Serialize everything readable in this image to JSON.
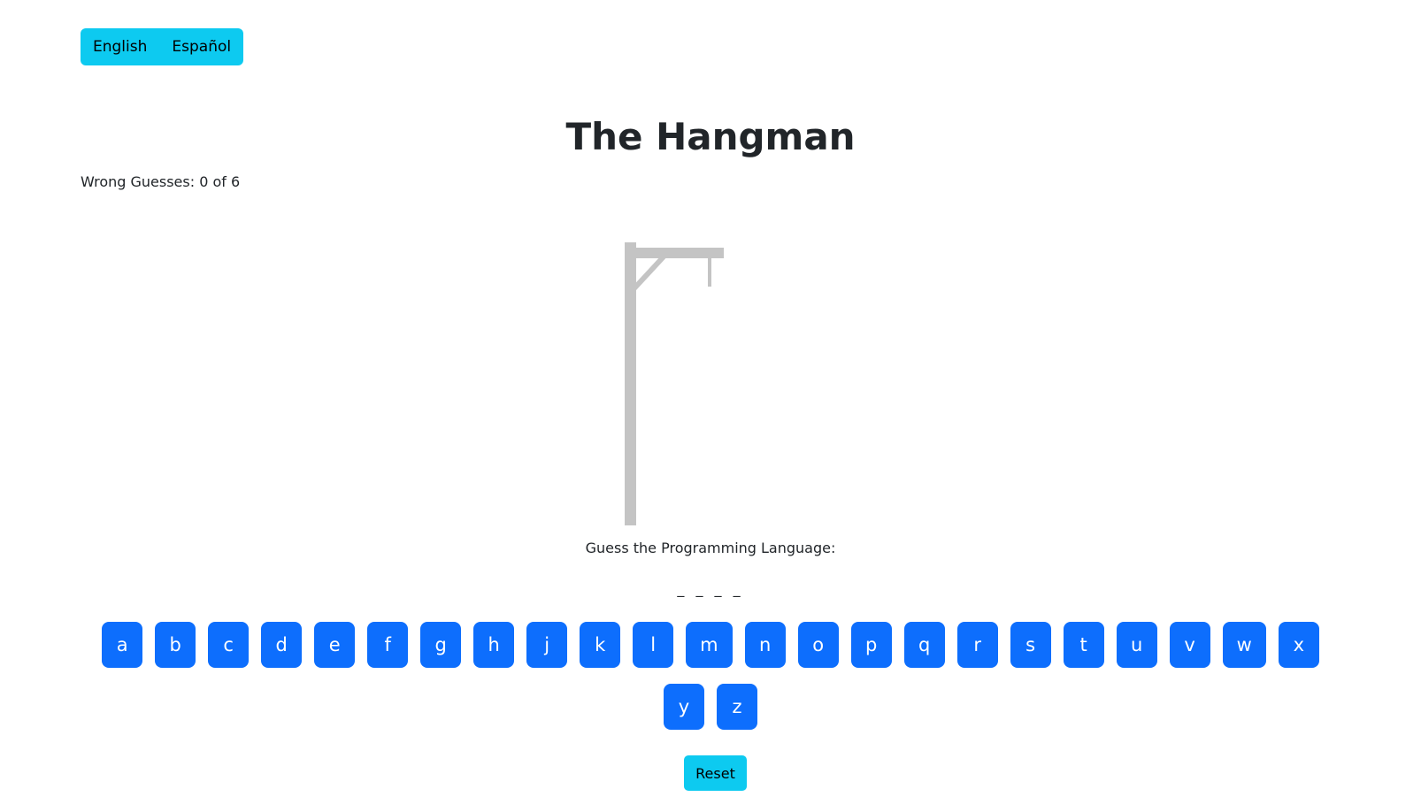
{
  "language_switch": {
    "english_label": "English",
    "spanish_label": "Español"
  },
  "title": "The Hangman",
  "status": {
    "wrong_guesses_text": "Wrong Guesses: 0 of 6",
    "wrong_guesses": 0,
    "max_guesses": 6
  },
  "hangman": {
    "icon": "gallows-icon",
    "color": "#c4c4c4"
  },
  "prompt": "Guess the Programming Language:",
  "word_display": "_ _ _ _",
  "keyboard": {
    "letters": [
      "a",
      "b",
      "c",
      "d",
      "e",
      "f",
      "g",
      "h",
      "j",
      "k",
      "l",
      "m",
      "n",
      "o",
      "p",
      "q",
      "r",
      "s",
      "t",
      "u",
      "v",
      "w",
      "x",
      "y",
      "z"
    ],
    "color": "#0d6efd"
  },
  "reset_label": "Reset",
  "colors": {
    "accent_info": "#0dcaf0",
    "primary": "#0d6efd"
  }
}
